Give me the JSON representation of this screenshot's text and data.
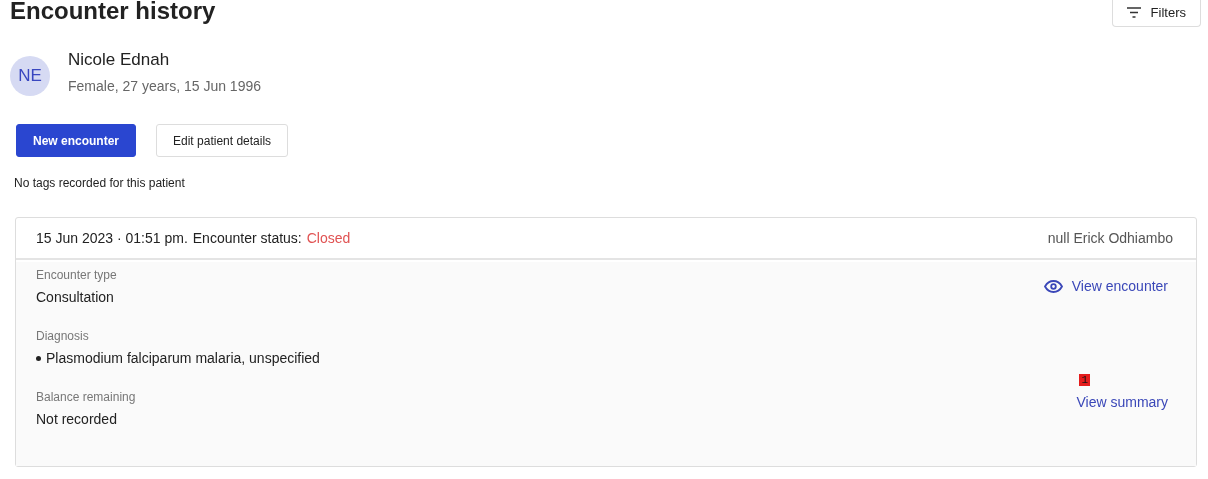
{
  "page": {
    "title": "Encounter history",
    "filters_button": "Filters"
  },
  "patient": {
    "initials": "NE",
    "name": "Nicole Ednah",
    "details": "Female, 27 years, 15 Jun 1996"
  },
  "actions": [
    {
      "label": "New encounter",
      "kind": "primary"
    },
    {
      "label": "Edit patient details",
      "kind": "secondary"
    }
  ],
  "tags_note": "No tags recorded for this patient",
  "encounter": {
    "datetime": "15 Jun 2023 · 01:51 pm.",
    "status_label": "Encounter status:",
    "status": "Closed",
    "closed": true,
    "clinician": "null Erick Odhiambo",
    "fields": [
      {
        "label": "Encounter type",
        "value": "Consultation",
        "kind": "text"
      },
      {
        "label": "Diagnosis",
        "value": "Plasmodium falciparum malaria, unspecified",
        "kind": "bullet"
      },
      {
        "label": "Balance remaining",
        "value": "Not recorded",
        "kind": "text"
      }
    ],
    "view_encounter": "View encounter",
    "view_summary": "View summary",
    "marker": "1"
  }
}
